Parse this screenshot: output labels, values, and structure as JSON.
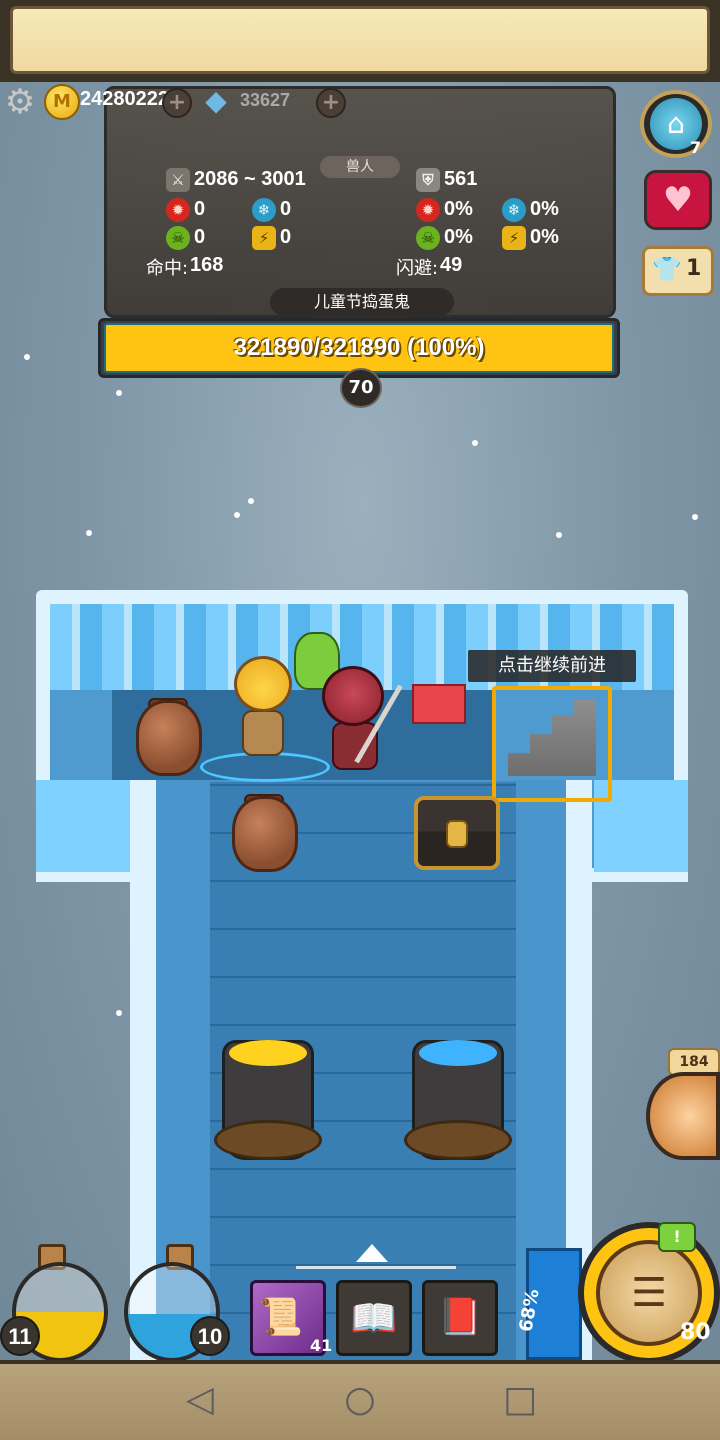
{
  "top_bar": {
    "gold_value": "24280222",
    "gem_value": "33627",
    "gold_icon": "coin-icon",
    "gem_icon": "diamond-icon"
  },
  "stats_panel": {
    "race": "兽人",
    "attack": "2086 ~ 3001",
    "defense": "561",
    "fire_attack": "0",
    "ice_attack": "0",
    "poison_attack": "0",
    "lightning_attack": "0",
    "fire_resist": "0%",
    "ice_resist": "0%",
    "poison_resist": "0%",
    "lightning_resist": "0%",
    "accuracy_label": "命中:",
    "accuracy_value": "168",
    "evasion_label": "闪避:",
    "evasion_value": "49",
    "enemy_name": "儿童节捣蛋鬼",
    "hp_text": "321890/321890 (100%)",
    "hp_fraction": 1.0,
    "level": "70"
  },
  "right_panel": {
    "home_count": "7",
    "shirt_count": "1",
    "orb_tag": "184"
  },
  "board": {
    "tooltip": "点击继续前进"
  },
  "bottom_hud": {
    "potion_yellow_count": "11",
    "potion_blue_count": "10",
    "scroll_count": "41",
    "progress_text": "68%",
    "skill_count": "80"
  },
  "colors": {
    "hp_fill": "#ffc412",
    "accent_gold": "#f2a900",
    "background": "#7f98a8"
  }
}
